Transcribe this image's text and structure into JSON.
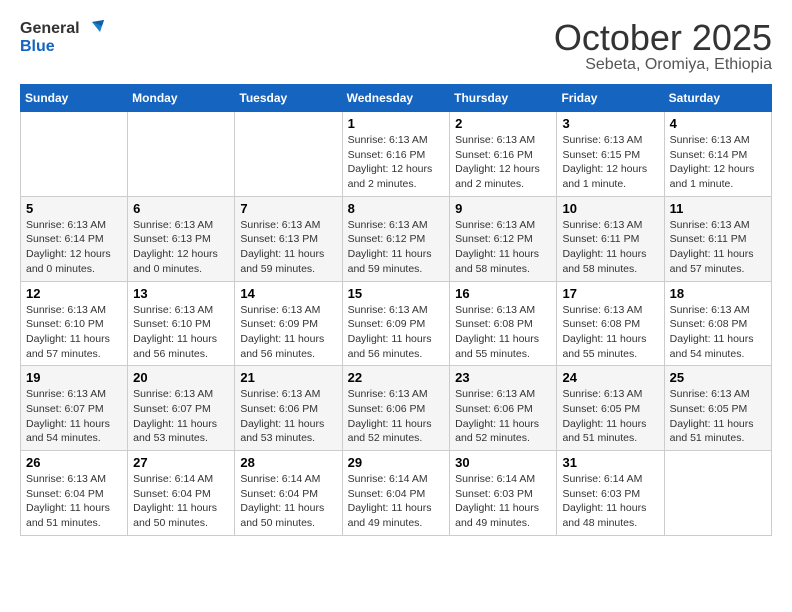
{
  "logo": {
    "line1": "General",
    "line2": "Blue"
  },
  "title": "October 2025",
  "subtitle": "Sebeta, Oromiya, Ethiopia",
  "weekdays": [
    "Sunday",
    "Monday",
    "Tuesday",
    "Wednesday",
    "Thursday",
    "Friday",
    "Saturday"
  ],
  "weeks": [
    [
      {
        "day": "",
        "info": ""
      },
      {
        "day": "",
        "info": ""
      },
      {
        "day": "",
        "info": ""
      },
      {
        "day": "1",
        "info": "Sunrise: 6:13 AM\nSunset: 6:16 PM\nDaylight: 12 hours\nand 2 minutes."
      },
      {
        "day": "2",
        "info": "Sunrise: 6:13 AM\nSunset: 6:16 PM\nDaylight: 12 hours\nand 2 minutes."
      },
      {
        "day": "3",
        "info": "Sunrise: 6:13 AM\nSunset: 6:15 PM\nDaylight: 12 hours\nand 1 minute."
      },
      {
        "day": "4",
        "info": "Sunrise: 6:13 AM\nSunset: 6:14 PM\nDaylight: 12 hours\nand 1 minute."
      }
    ],
    [
      {
        "day": "5",
        "info": "Sunrise: 6:13 AM\nSunset: 6:14 PM\nDaylight: 12 hours\nand 0 minutes."
      },
      {
        "day": "6",
        "info": "Sunrise: 6:13 AM\nSunset: 6:13 PM\nDaylight: 12 hours\nand 0 minutes."
      },
      {
        "day": "7",
        "info": "Sunrise: 6:13 AM\nSunset: 6:13 PM\nDaylight: 11 hours\nand 59 minutes."
      },
      {
        "day": "8",
        "info": "Sunrise: 6:13 AM\nSunset: 6:12 PM\nDaylight: 11 hours\nand 59 minutes."
      },
      {
        "day": "9",
        "info": "Sunrise: 6:13 AM\nSunset: 6:12 PM\nDaylight: 11 hours\nand 58 minutes."
      },
      {
        "day": "10",
        "info": "Sunrise: 6:13 AM\nSunset: 6:11 PM\nDaylight: 11 hours\nand 58 minutes."
      },
      {
        "day": "11",
        "info": "Sunrise: 6:13 AM\nSunset: 6:11 PM\nDaylight: 11 hours\nand 57 minutes."
      }
    ],
    [
      {
        "day": "12",
        "info": "Sunrise: 6:13 AM\nSunset: 6:10 PM\nDaylight: 11 hours\nand 57 minutes."
      },
      {
        "day": "13",
        "info": "Sunrise: 6:13 AM\nSunset: 6:10 PM\nDaylight: 11 hours\nand 56 minutes."
      },
      {
        "day": "14",
        "info": "Sunrise: 6:13 AM\nSunset: 6:09 PM\nDaylight: 11 hours\nand 56 minutes."
      },
      {
        "day": "15",
        "info": "Sunrise: 6:13 AM\nSunset: 6:09 PM\nDaylight: 11 hours\nand 56 minutes."
      },
      {
        "day": "16",
        "info": "Sunrise: 6:13 AM\nSunset: 6:08 PM\nDaylight: 11 hours\nand 55 minutes."
      },
      {
        "day": "17",
        "info": "Sunrise: 6:13 AM\nSunset: 6:08 PM\nDaylight: 11 hours\nand 55 minutes."
      },
      {
        "day": "18",
        "info": "Sunrise: 6:13 AM\nSunset: 6:08 PM\nDaylight: 11 hours\nand 54 minutes."
      }
    ],
    [
      {
        "day": "19",
        "info": "Sunrise: 6:13 AM\nSunset: 6:07 PM\nDaylight: 11 hours\nand 54 minutes."
      },
      {
        "day": "20",
        "info": "Sunrise: 6:13 AM\nSunset: 6:07 PM\nDaylight: 11 hours\nand 53 minutes."
      },
      {
        "day": "21",
        "info": "Sunrise: 6:13 AM\nSunset: 6:06 PM\nDaylight: 11 hours\nand 53 minutes."
      },
      {
        "day": "22",
        "info": "Sunrise: 6:13 AM\nSunset: 6:06 PM\nDaylight: 11 hours\nand 52 minutes."
      },
      {
        "day": "23",
        "info": "Sunrise: 6:13 AM\nSunset: 6:06 PM\nDaylight: 11 hours\nand 52 minutes."
      },
      {
        "day": "24",
        "info": "Sunrise: 6:13 AM\nSunset: 6:05 PM\nDaylight: 11 hours\nand 51 minutes."
      },
      {
        "day": "25",
        "info": "Sunrise: 6:13 AM\nSunset: 6:05 PM\nDaylight: 11 hours\nand 51 minutes."
      }
    ],
    [
      {
        "day": "26",
        "info": "Sunrise: 6:13 AM\nSunset: 6:04 PM\nDaylight: 11 hours\nand 51 minutes."
      },
      {
        "day": "27",
        "info": "Sunrise: 6:14 AM\nSunset: 6:04 PM\nDaylight: 11 hours\nand 50 minutes."
      },
      {
        "day": "28",
        "info": "Sunrise: 6:14 AM\nSunset: 6:04 PM\nDaylight: 11 hours\nand 50 minutes."
      },
      {
        "day": "29",
        "info": "Sunrise: 6:14 AM\nSunset: 6:04 PM\nDaylight: 11 hours\nand 49 minutes."
      },
      {
        "day": "30",
        "info": "Sunrise: 6:14 AM\nSunset: 6:03 PM\nDaylight: 11 hours\nand 49 minutes."
      },
      {
        "day": "31",
        "info": "Sunrise: 6:14 AM\nSunset: 6:03 PM\nDaylight: 11 hours\nand 48 minutes."
      },
      {
        "day": "",
        "info": ""
      }
    ]
  ]
}
